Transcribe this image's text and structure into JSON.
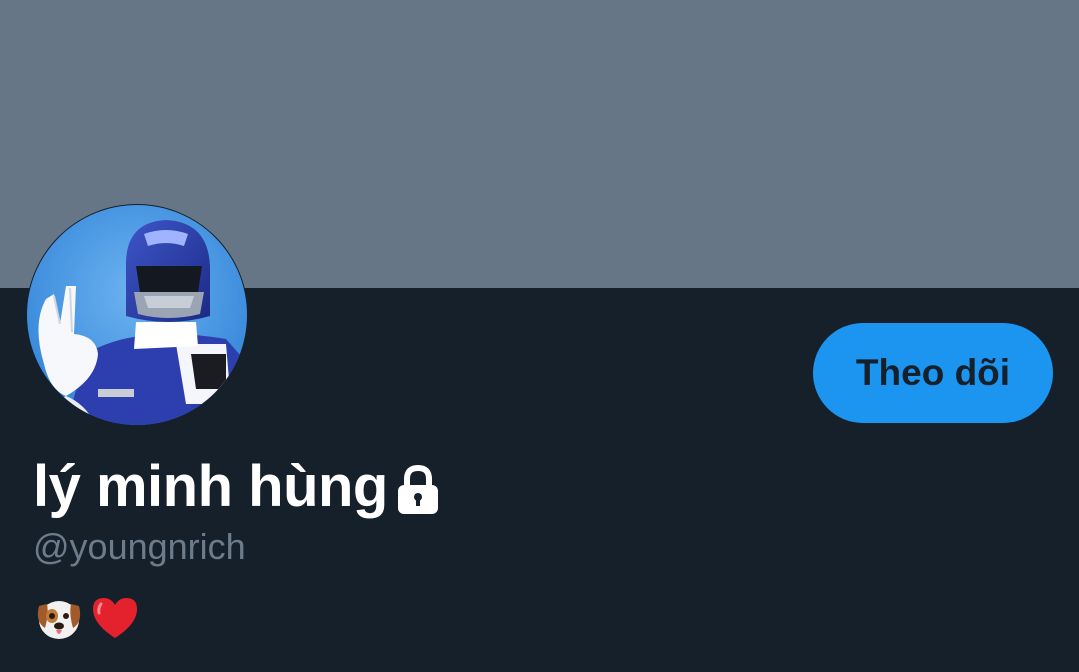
{
  "profile": {
    "display_name": "lý minh hùng",
    "handle": "@youngnrich",
    "locked_icon": "lock-icon",
    "bio_emojis": [
      "dog-face-emoji",
      "red-heart-emoji"
    ],
    "avatar_description": "blue-ranger-avatar"
  },
  "actions": {
    "follow_label": "Theo dõi"
  },
  "colors": {
    "banner": "#667687",
    "background": "#16202b",
    "accent": "#1c95f0",
    "name_text": "#ffffff",
    "handle_text": "#6d7c8b"
  }
}
